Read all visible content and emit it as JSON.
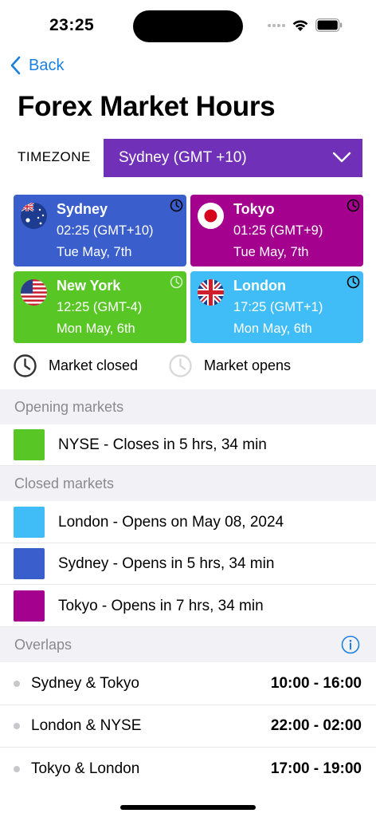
{
  "status_bar": {
    "time": "23:25"
  },
  "nav": {
    "back_label": "Back",
    "title": "Forex Market Hours"
  },
  "timezone": {
    "label": "TIMEZONE",
    "selected": "Sydney (GMT +10)"
  },
  "markets": [
    {
      "city": "Sydney",
      "time": "02:25 (GMT+10)",
      "date": "Tue May, 7th",
      "color": "#3a5fcd",
      "flag": "australia-flag-icon"
    },
    {
      "city": "Tokyo",
      "time": "01:25 (GMT+9)",
      "date": "Tue May, 7th",
      "color": "#a3018e",
      "flag": "japan-flag-icon"
    },
    {
      "city": "New York",
      "time": "12:25 (GMT-4)",
      "date": "Mon May, 6th",
      "color": "#58c725",
      "flag": "usa-flag-icon"
    },
    {
      "city": "London",
      "time": "17:25 (GMT+1)",
      "date": "Mon May, 6th",
      "color": "#40bdf6",
      "flag": "uk-flag-icon"
    }
  ],
  "legend": {
    "closed": "Market closed",
    "opens": "Market opens"
  },
  "opening_markets": {
    "header": "Opening markets",
    "items": [
      {
        "label": "NYSE - Closes in 5 hrs, 34 min",
        "color": "#58c725"
      }
    ]
  },
  "closed_markets": {
    "header": "Closed markets",
    "items": [
      {
        "label": "London - Opens on May 08, 2024",
        "color": "#40bdf6"
      },
      {
        "label": "Sydney - Opens in 5 hrs, 34 min",
        "color": "#3a5fcd"
      },
      {
        "label": "Tokyo - Opens in 7 hrs, 34 min",
        "color": "#a3018e"
      }
    ]
  },
  "overlaps": {
    "header": "Overlaps",
    "items": [
      {
        "name": "Sydney & Tokyo",
        "range": "10:00 - 16:00"
      },
      {
        "name": "London & NYSE",
        "range": "22:00 - 02:00"
      },
      {
        "name": "Tokyo & London",
        "range": "17:00 - 19:00"
      }
    ]
  },
  "colors": {
    "accent": "#1a80e0",
    "timezone_bg": "#7030b8"
  }
}
